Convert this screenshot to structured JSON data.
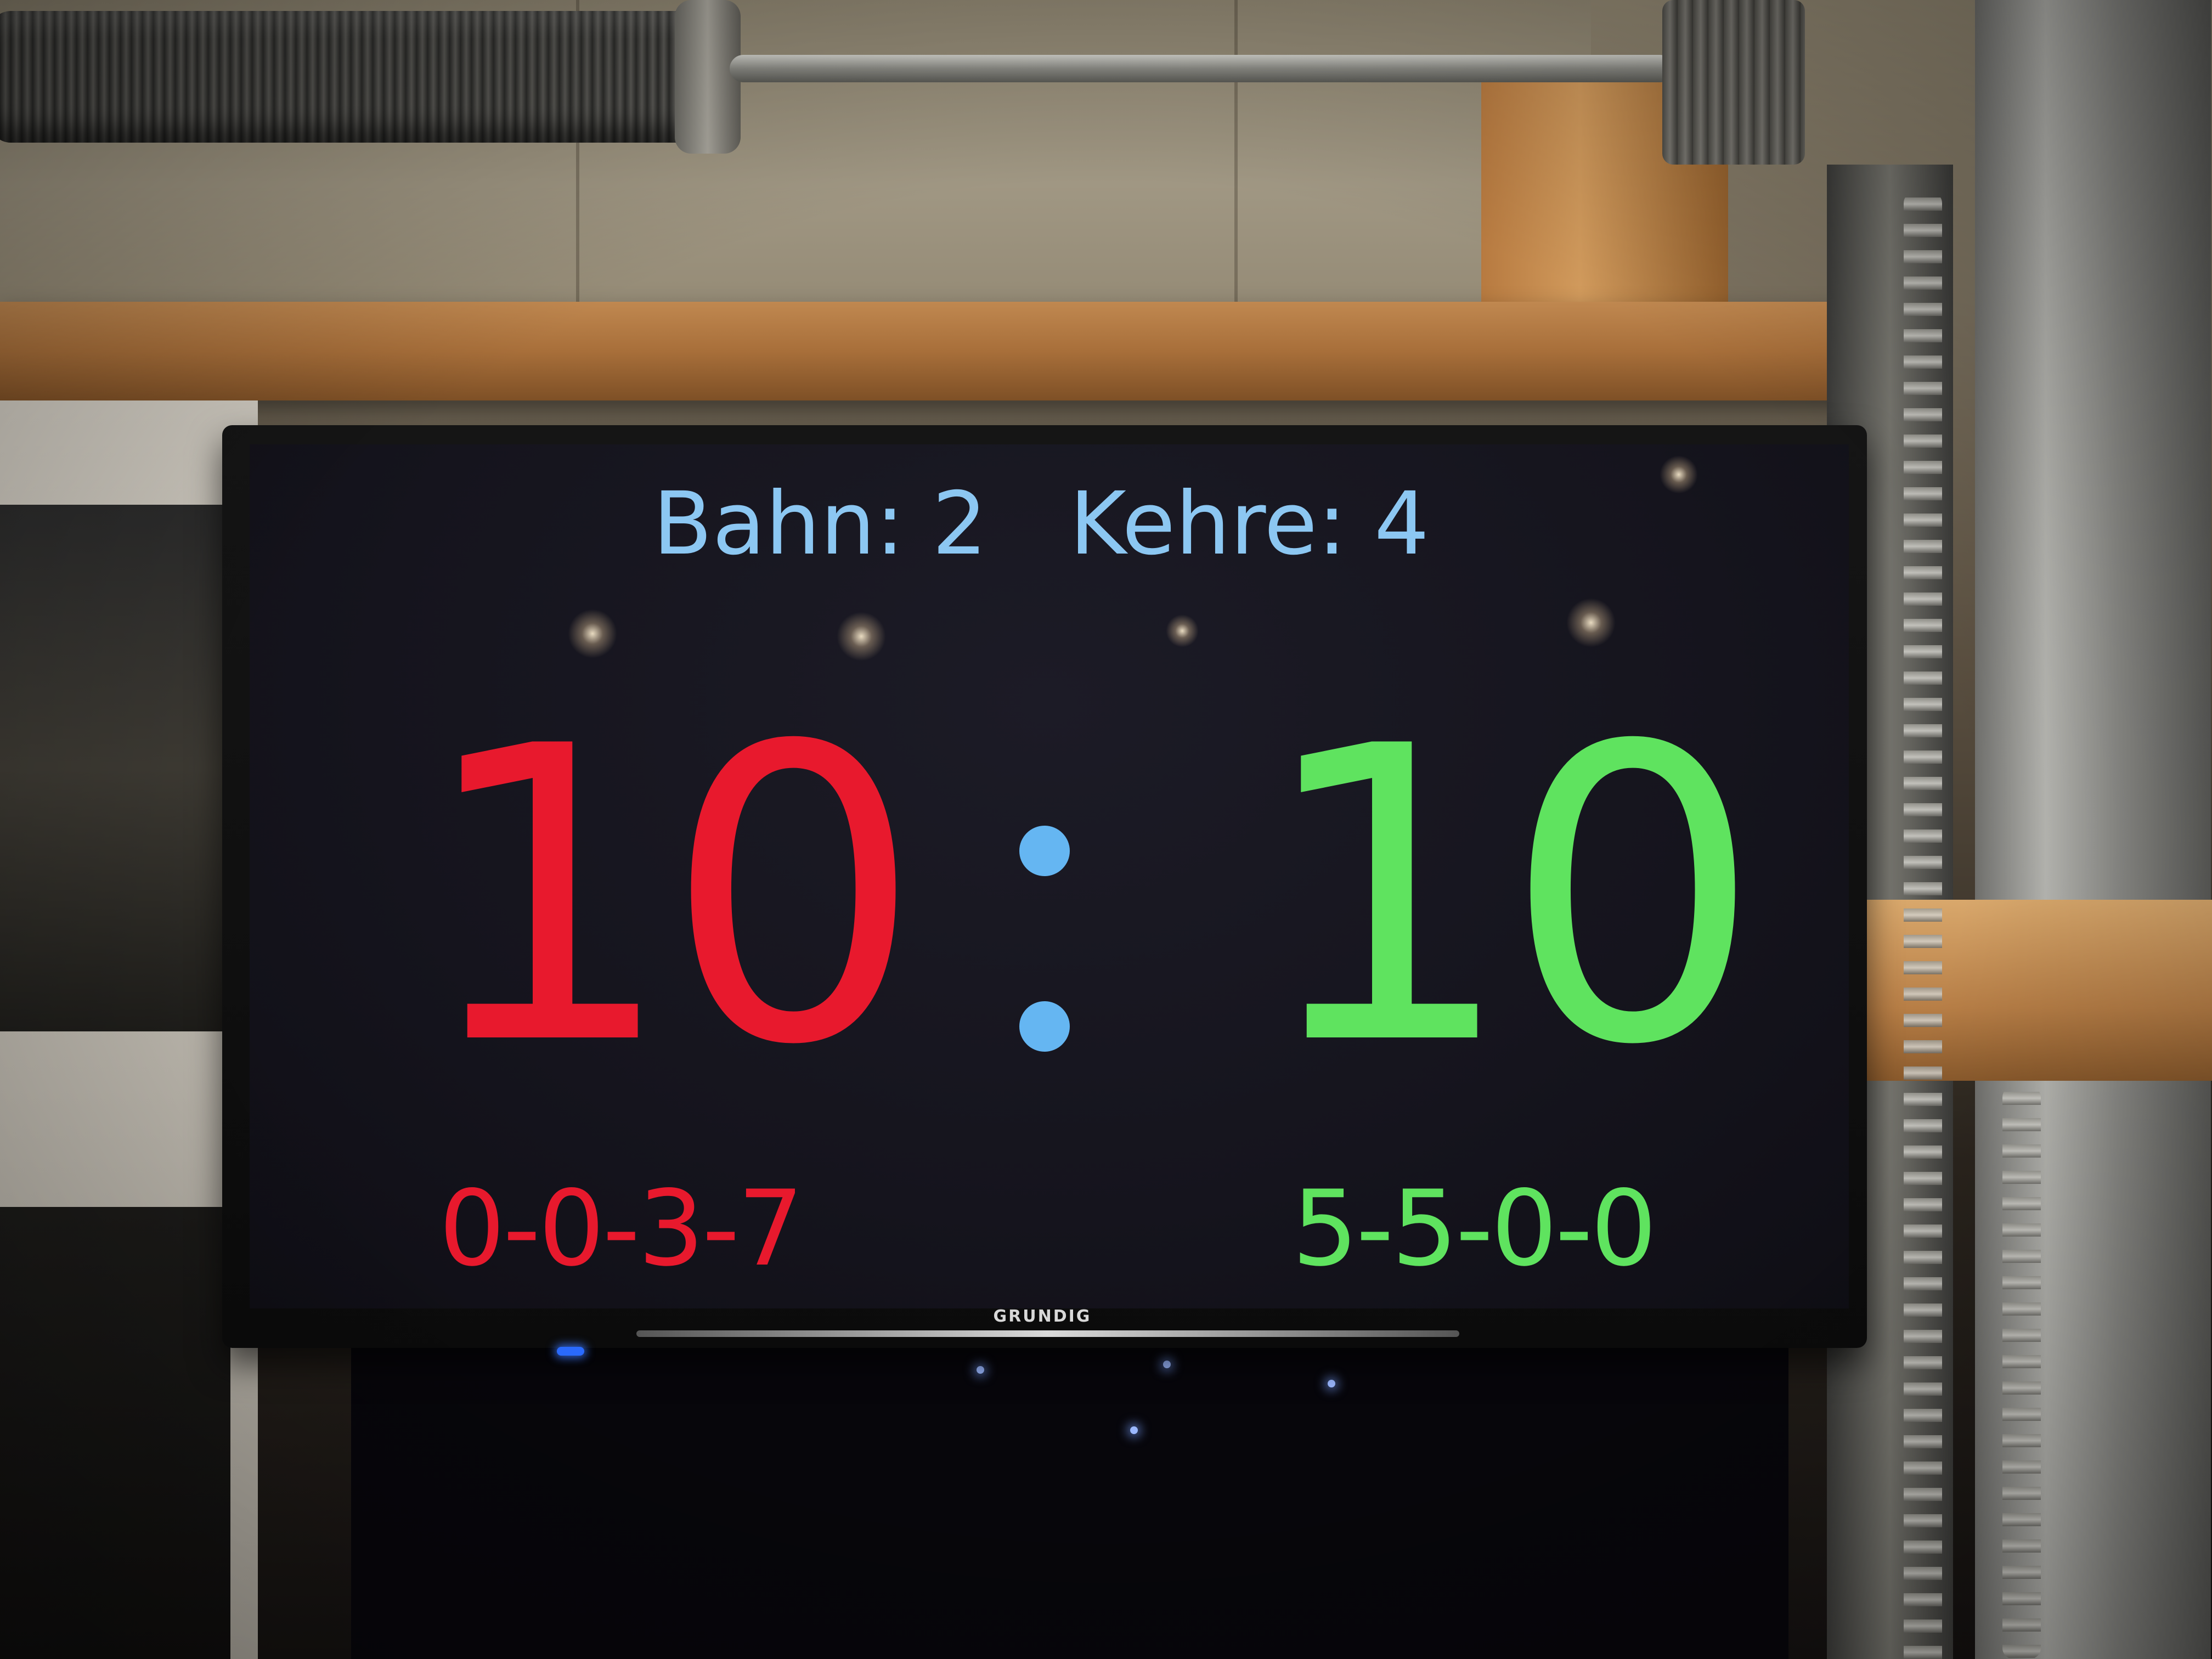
{
  "scoreboard": {
    "lane_label": "Bahn: 2",
    "turn_label": "Kehre: 4",
    "home_score": "10",
    "away_score": "10",
    "home_frames": "0-0-3-7",
    "away_frames": "5-5-0-0",
    "home_color": "#e8192d",
    "away_color": "#5fe35f",
    "info_color": "#8cc7f2",
    "separator_color": "#65b6f2"
  },
  "tv": {
    "brand": "GRUNDIG"
  }
}
